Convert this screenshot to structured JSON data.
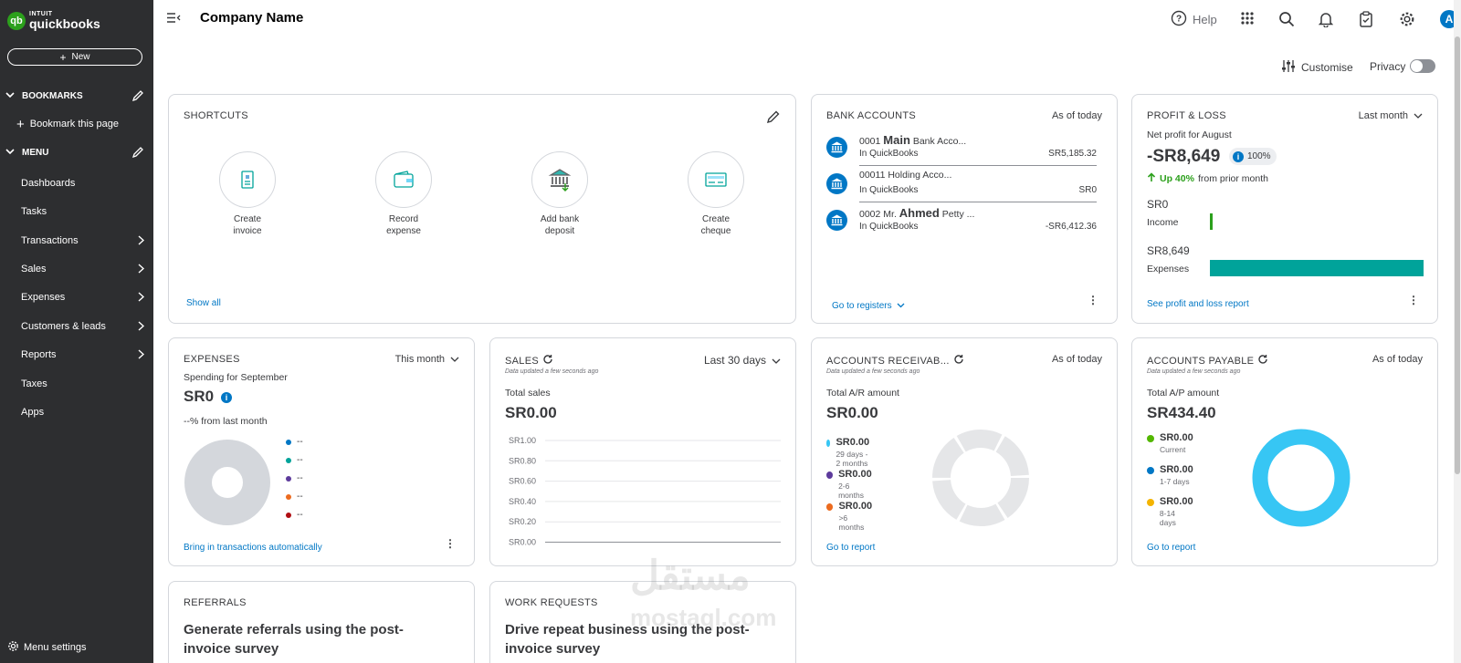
{
  "app": {
    "brand_small": "INTUIT",
    "brand_big": "quickbooks",
    "brand_mark": "qb"
  },
  "sidebar": {
    "new_label": "New",
    "bookmarks_label": "BOOKMARKS",
    "bookmark_page": "Bookmark this page",
    "menu_label": "MENU",
    "items": [
      {
        "label": "Dashboards",
        "arrow": false
      },
      {
        "label": "Tasks",
        "arrow": false
      },
      {
        "label": "Transactions",
        "arrow": true
      },
      {
        "label": "Sales",
        "arrow": true
      },
      {
        "label": "Expenses",
        "arrow": true
      },
      {
        "label": "Customers & leads",
        "arrow": true
      },
      {
        "label": "Reports",
        "arrow": true
      },
      {
        "label": "Taxes",
        "arrow": false
      },
      {
        "label": "Apps",
        "arrow": false
      }
    ],
    "menu_settings": "Menu settings"
  },
  "header": {
    "company": "Company Name",
    "help": "Help",
    "avatar": "A",
    "customise": "Customise",
    "privacy": "Privacy"
  },
  "shortcuts": {
    "title": "SHORTCUTS",
    "items": [
      {
        "line1": "Create",
        "line2": "invoice"
      },
      {
        "line1": "Record",
        "line2": "expense"
      },
      {
        "line1": "Add bank",
        "line2": "deposit"
      },
      {
        "line1": "Create",
        "line2": "cheque"
      }
    ],
    "show_all": "Show all"
  },
  "bank_accounts": {
    "title": "BANK ACCOUNTS",
    "as_of": "As of today",
    "rows": [
      {
        "num": "0001",
        "bold": "Main",
        "rest": "Bank Acco...",
        "sub": "In QuickBooks",
        "balance": "SR5,185.32"
      },
      {
        "num": "00011",
        "bold": "",
        "rest": "Holding Acco...",
        "sub": "In QuickBooks",
        "balance": "SR0"
      },
      {
        "num": "0002 Mr.",
        "bold": "Ahmed",
        "rest": "Petty ...",
        "sub": "In QuickBooks",
        "balance": "-SR6,412.36"
      }
    ],
    "link": "Go to registers"
  },
  "profit_loss": {
    "title": "PROFIT & LOSS",
    "period": "Last month",
    "subtitle": "Net profit for August",
    "amount": "-SR8,649",
    "badge": "100%",
    "up": "Up 40%",
    "up_rest": "from prior month",
    "income_value": "SR0",
    "income_label": "Income",
    "expenses_value": "SR8,649",
    "expenses_label": "Expenses",
    "link": "See profit and loss report",
    "colors": {
      "income": "#2ca01c",
      "expenses": "#00a39a"
    }
  },
  "expenses": {
    "title": "EXPENSES",
    "period": "This month",
    "subtitle": "Spending for September",
    "amount": "SR0",
    "change": "--% from last month",
    "legend": [
      {
        "label": "--",
        "color": "#0077c5"
      },
      {
        "label": "--",
        "color": "#00a39a"
      },
      {
        "label": "--",
        "color": "#5d3b9c"
      },
      {
        "label": "--",
        "color": "#ec6b1f"
      },
      {
        "label": "--",
        "color": "#b00e13"
      }
    ],
    "link": "Bring in transactions automatically"
  },
  "sales": {
    "title": "SALES",
    "period": "Last 30 days",
    "updated": "Data updated a few seconds ago",
    "subtitle": "Total sales",
    "amount": "SR0.00",
    "ticks": [
      "SR1.00",
      "SR0.80",
      "SR0.60",
      "SR0.40",
      "SR0.20",
      "SR0.00"
    ]
  },
  "receivable": {
    "title": "ACCOUNTS RECEIVAB...",
    "as_of": "As of today",
    "updated": "Data updated a few seconds ago",
    "subtitle": "Total A/R amount",
    "amount": "SR0.00",
    "legend": [
      {
        "value": "SR0.00",
        "label": "29 days - 2 months",
        "color": "#37c6f4"
      },
      {
        "value": "SR0.00",
        "label": "2-6 months",
        "color": "#5d3b9c"
      },
      {
        "value": "SR0.00",
        "label": ">6 months",
        "color": "#ec6b1f"
      }
    ],
    "link": "Go to report"
  },
  "payable": {
    "title": "ACCOUNTS PAYABLE",
    "as_of": "As of today",
    "updated": "Data updated a few seconds ago",
    "subtitle": "Total A/P amount",
    "amount": "SR434.40",
    "legend": [
      {
        "value": "SR0.00",
        "label": "Current",
        "color": "#53b700"
      },
      {
        "value": "SR0.00",
        "label": "1-7 days",
        "color": "#0077c5"
      },
      {
        "value": "SR0.00",
        "label": "8-14 days",
        "color": "#f4b400"
      }
    ],
    "donut_color": "#37c6f4",
    "link": "Go to report"
  },
  "referrals": {
    "title": "REFERRALS",
    "line1": "Generate referrals using the post-",
    "line2": "invoice survey"
  },
  "work_requests": {
    "title": "WORK REQUESTS",
    "line1": "Drive repeat business using the post-",
    "line2": "invoice survey"
  },
  "watermark": {
    "line1": "مستقل",
    "line2": "mostaql.com"
  }
}
